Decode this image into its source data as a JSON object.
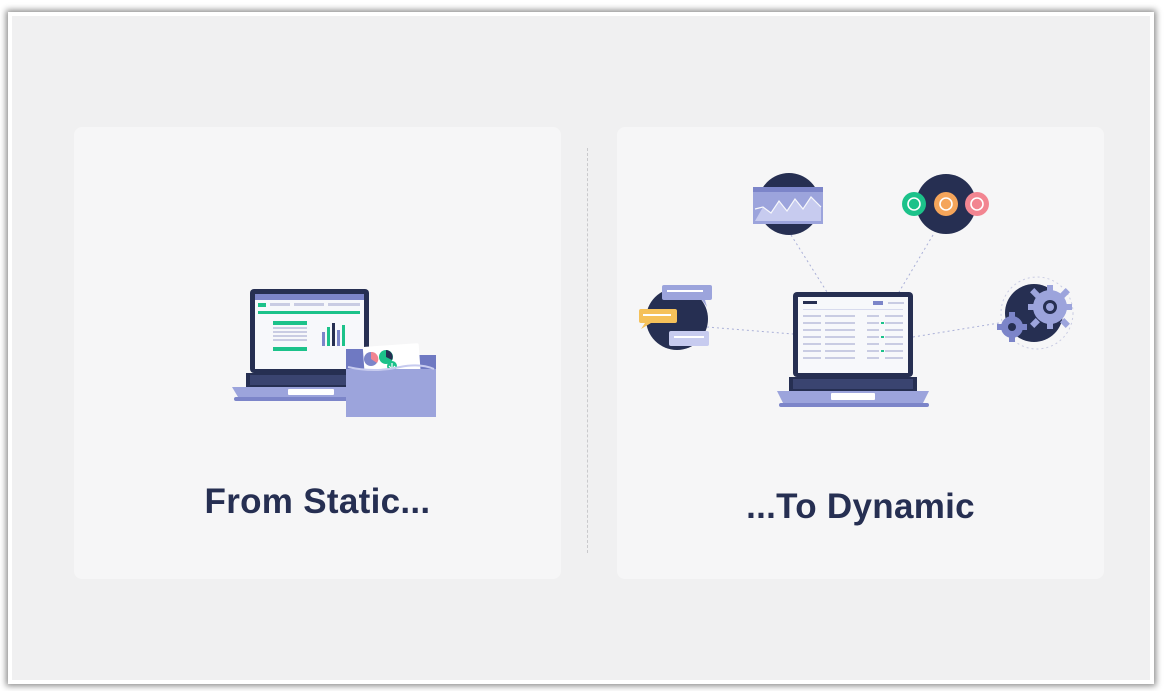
{
  "panels": [
    {
      "caption": "From Static...",
      "illustration": "laptop-with-spreadsheet-and-folder-icon"
    },
    {
      "caption": "...To Dynamic",
      "illustration": "laptop-connected-to-apps-icon",
      "satellites": [
        "chart-card-icon",
        "status-dots-icon",
        "chat-bubbles-icon",
        "gears-icon"
      ]
    }
  ],
  "colors": {
    "navy": "#262f52",
    "lavender": "#8e96d3",
    "green": "#1cc28a",
    "orange": "#f5a55a",
    "pink": "#f28591"
  }
}
